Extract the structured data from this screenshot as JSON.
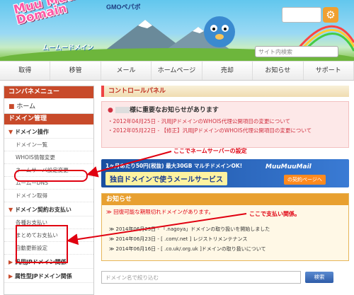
{
  "brand": {
    "gmo": "GMOペパボ",
    "logo": "Muu Muu Domain",
    "sub": "ムームードメイン"
  },
  "search": {
    "placeholder": "サイト内検索"
  },
  "nav": [
    "取得",
    "移管",
    "メール",
    "ホームページ",
    "売却",
    "お知らせ",
    "サポート"
  ],
  "sidebar": {
    "header": "コンバネメニュー",
    "home": "ホーム",
    "section": "ドメイン管理",
    "group1": "ドメイン操作",
    "items1": [
      "ドメイン一覧",
      "WHOIS情報変更",
      "ネームサーバ設定変更",
      "ムームーDNS",
      "ドメイン取得"
    ],
    "group2": "ドメイン契約お支払い",
    "items2": [
      "各種お支払い",
      "まとめてお支払い",
      "自動更新設定"
    ],
    "group3": "汎用JPドメイン関係",
    "group4": "属性型JPドメイン関係"
  },
  "panel": {
    "title": "コントロールパネル",
    "notice_title": "様に重要なお知らせがあります",
    "notices": [
      "・2012年04月25日 - 汎用JPドメインのWHOIS代理公開項目の変更について",
      "・2012年05月22日 - 【修正】汎用JPドメインのWHOIS代理公開項目の変更について"
    ]
  },
  "annotations": {
    "nameserver": "ここでネームサーバーの設定",
    "payment": "ここで支払い関係。"
  },
  "banner": {
    "line1": "1ヶ月あたり50円(税抜) 最大30GB マルチドメインOK!",
    "line2": "独自ドメインで使うメールサービス",
    "brand": "MuuMuuMail",
    "cta": "の契約ページへ"
  },
  "info": {
    "title": "お知らせ",
    "alert": "≫ 回復可能な期限切れドメインがあります。",
    "items": [
      "≫ 2014年06月23日 - 「.nagoya」ドメインの取り扱いを開始しました",
      "≫ 2014年06月23日 - [ .com/.net ] レジストリメンテナンス",
      "≫ 2014年06月16日 - [ .co.uk/.org.uk ]ドメインの取り扱いについて"
    ]
  },
  "filter": {
    "placeholder": "ドメイン名で絞り込む",
    "button": "検索"
  }
}
